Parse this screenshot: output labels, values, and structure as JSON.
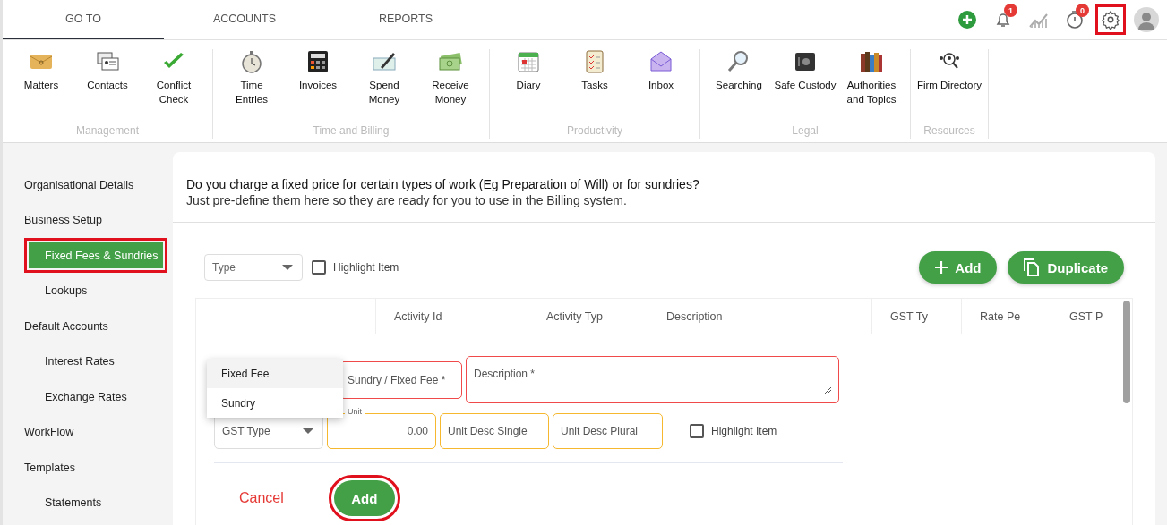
{
  "top_tabs": [
    {
      "label": "GO TO",
      "selected": true
    },
    {
      "label": "ACCOUNTS",
      "selected": false
    },
    {
      "label": "REPORTS",
      "selected": false
    }
  ],
  "toolbar_icons": [
    {
      "kind": "add",
      "highlighted": false
    },
    {
      "kind": "bell",
      "badge": "1",
      "highlighted": false
    },
    {
      "kind": "chart",
      "highlighted": false
    },
    {
      "kind": "timer",
      "badge": "0",
      "highlighted": false
    },
    {
      "kind": "settings",
      "highlighted": true
    },
    {
      "kind": "avatar",
      "highlighted": false
    }
  ],
  "ribbon": [
    {
      "label": "Management",
      "items": [
        {
          "label": "Matters"
        },
        {
          "label": "Contacts"
        },
        {
          "label": "Conflict\nCheck"
        }
      ]
    },
    {
      "label": "Time and Billing",
      "items": [
        {
          "label": "Time\nEntries"
        },
        {
          "label": "Invoices"
        },
        {
          "label": "Spend\nMoney"
        },
        {
          "label": "Receive\nMoney"
        }
      ]
    },
    {
      "label": "Productivity",
      "items": [
        {
          "label": "Diary"
        },
        {
          "label": "Tasks"
        },
        {
          "label": "Inbox"
        }
      ]
    },
    {
      "label": "Legal",
      "items": [
        {
          "label": "Searching"
        },
        {
          "label": "Safe Custody"
        },
        {
          "label": "Authorities\nand Topics"
        }
      ]
    },
    {
      "label": "Resources",
      "items": [
        {
          "label": "Firm Directory"
        }
      ]
    }
  ],
  "sidebar": {
    "items": [
      {
        "label": "Organisational Details",
        "selected": false,
        "highlighted": false
      },
      {
        "label": "Business Setup",
        "selected": false,
        "highlighted": false,
        "children": [
          {
            "label": "Fixed Fees & Sundries",
            "selected": true,
            "highlighted": true
          },
          {
            "label": "Lookups",
            "selected": false,
            "highlighted": false
          }
        ]
      },
      {
        "label": "Default Accounts",
        "selected": false,
        "highlighted": false,
        "children": [
          {
            "label": "Interest Rates",
            "selected": false,
            "highlighted": false
          },
          {
            "label": "Exchange Rates",
            "selected": false,
            "highlighted": false
          }
        ]
      },
      {
        "label": "WorkFlow",
        "selected": false,
        "highlighted": false
      },
      {
        "label": "Templates",
        "selected": false,
        "highlighted": false,
        "children": [
          {
            "label": "Statements",
            "selected": false,
            "highlighted": false
          }
        ]
      }
    ]
  },
  "intro": [
    "Do you charge a fixed price for certain types of work (Eg Preparation of Will) or for sundries?",
    "Just pre-define them here so they are ready for you to use in the Billing system."
  ],
  "filter_bar": {
    "type_select": {
      "placeholder": "Type"
    },
    "highlight_checkbox": {
      "label": "Highlight Item",
      "checked": false
    },
    "buttons": [
      {
        "label": "Add",
        "kind": "add"
      },
      {
        "label": "Duplicate",
        "kind": "duplicate"
      }
    ]
  },
  "table": {
    "columns": [
      "Activity Id",
      "Activity Typ",
      "Description",
      "GST Ty",
      "Rate Pe",
      "GST P"
    ]
  },
  "form": {
    "activity_type_menu": {
      "options": [
        {
          "label": "Fixed Fee",
          "selected": true
        },
        {
          "label": "Sundry",
          "selected": false
        }
      ]
    },
    "row_1": [
      {
        "kind": "text",
        "placeholder": "Sundry / Fixed Fee *",
        "color": "#f04a4a"
      },
      {
        "kind": "textarea",
        "placeholder": "Description *",
        "color": "#f04a4a"
      }
    ],
    "row_2": [
      {
        "kind": "select",
        "placeholder": "GST Type",
        "color": "#dddddd"
      },
      {
        "kind": "number",
        "label": "Unit",
        "value": "0.00",
        "color": "#f5b82e"
      },
      {
        "kind": "text",
        "placeholder": "Unit Desc Single",
        "color": "#f5b82e"
      },
      {
        "kind": "text",
        "placeholder": "Unit Desc Plural",
        "color": "#f5b82e"
      }
    ],
    "highlight_checkbox": {
      "label": "Highlight Item",
      "checked": false
    },
    "actions": [
      {
        "label": "Cancel",
        "kind": "cancel",
        "highlighted": false
      },
      {
        "label": "Add",
        "kind": "primary",
        "highlighted": true
      }
    ]
  }
}
